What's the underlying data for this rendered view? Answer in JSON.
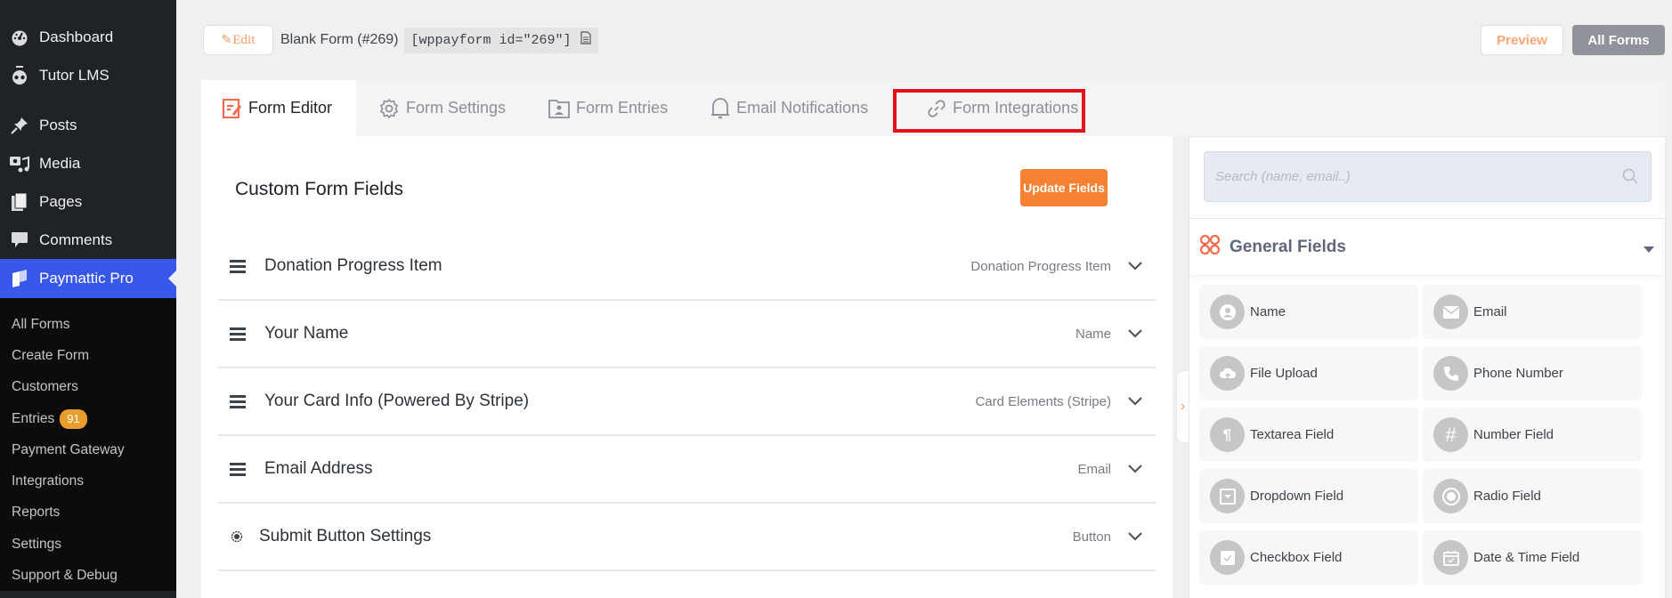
{
  "sidebar": {
    "main_items": [
      {
        "label": "Dashboard",
        "icon": "dashboard-icon"
      },
      {
        "label": "Tutor LMS",
        "icon": "tutor-lms-icon"
      },
      {
        "label": "Posts",
        "icon": "pin-icon"
      },
      {
        "label": "Media",
        "icon": "media-icon"
      },
      {
        "label": "Pages",
        "icon": "pages-icon"
      },
      {
        "label": "Comments",
        "icon": "comment-icon"
      },
      {
        "label": "Paymattic Pro",
        "icon": "paymattic-icon",
        "active": true
      }
    ],
    "sub_items": [
      {
        "label": "All Forms"
      },
      {
        "label": "Create Form"
      },
      {
        "label": "Customers"
      },
      {
        "label": "Entries",
        "badge": "91"
      },
      {
        "label": "Payment Gateway"
      },
      {
        "label": "Integrations"
      },
      {
        "label": "Reports"
      },
      {
        "label": "Settings"
      },
      {
        "label": "Support & Debug"
      }
    ],
    "active_color": "#3858e9",
    "badge_color": "#e99d2c"
  },
  "header": {
    "edit_label": "Edit",
    "form_title": "Blank Form (#269)",
    "shortcode": "[wppayform id=\"269\"]",
    "preview_label": "Preview",
    "all_forms_label": "All Forms"
  },
  "tabs": [
    {
      "label": "Form Editor",
      "icon": "form-editor-icon",
      "active": true
    },
    {
      "label": "Form Settings",
      "icon": "gear-icon"
    },
    {
      "label": "Form Entries",
      "icon": "entries-icon"
    },
    {
      "label": "Email Notifications",
      "icon": "bell-icon"
    },
    {
      "label": "Form Integrations",
      "icon": "link-icon",
      "highlighted": true
    }
  ],
  "editor": {
    "title": "Custom Form Fields",
    "update_label": "Update Fields",
    "fields": [
      {
        "name": "Donation Progress Item",
        "type": "Donation Progress Item"
      },
      {
        "name": "Your Name",
        "type": "Name"
      },
      {
        "name": "Your Card Info (Powered By Stripe)",
        "type": "Card Elements (Stripe)"
      },
      {
        "name": "Email Address",
        "type": "Email"
      },
      {
        "name": "Submit Button Settings",
        "type": "Button"
      }
    ]
  },
  "palette": {
    "search_placeholder": "Search (name, email..)",
    "section_title": "General Fields",
    "items": [
      {
        "label": "Name",
        "icon": "user-icon"
      },
      {
        "label": "Email",
        "icon": "envelope-icon"
      },
      {
        "label": "File Upload",
        "icon": "cloud-upload-icon"
      },
      {
        "label": "Phone Number",
        "icon": "phone-icon"
      },
      {
        "label": "Textarea Field",
        "icon": "paragraph-icon"
      },
      {
        "label": "Number Field",
        "icon": "hash-icon"
      },
      {
        "label": "Dropdown Field",
        "icon": "dropdown-icon"
      },
      {
        "label": "Radio Field",
        "icon": "radio-icon"
      },
      {
        "label": "Checkbox Field",
        "icon": "checkbox-icon"
      },
      {
        "label": "Date & Time Field",
        "icon": "calendar-icon"
      }
    ]
  },
  "colors": {
    "accent_orange": "#f58233",
    "highlight_red": "#e1121c"
  }
}
